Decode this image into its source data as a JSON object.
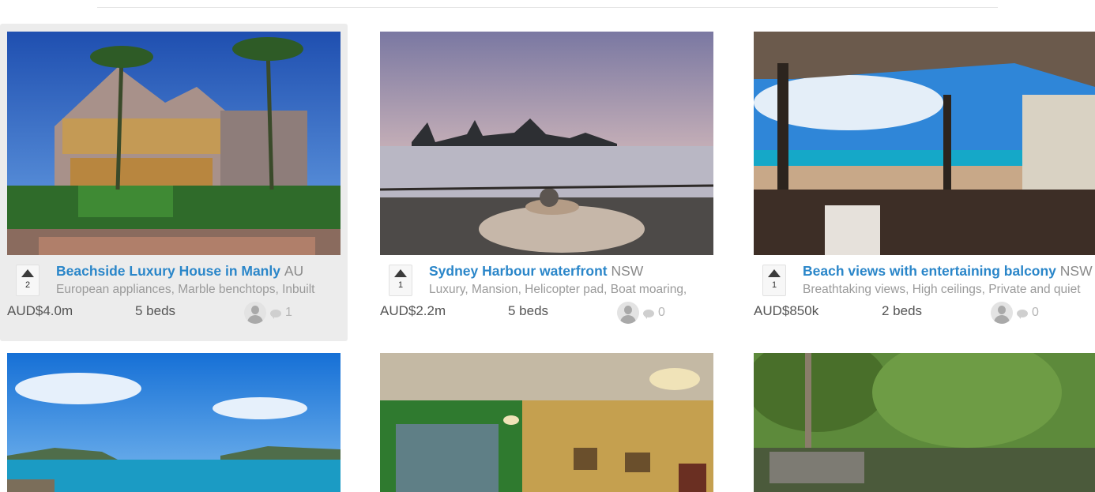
{
  "listings": [
    {
      "title": "Beachside Luxury House in Manly",
      "region": "AU",
      "description": "European appliances, Marble benchtops, Inbuilt",
      "votes": "2",
      "price": "AUD$4.0m",
      "beds": "5 beds",
      "comments": "1"
    },
    {
      "title": "Sydney Harbour waterfront",
      "region": "NSW",
      "description": "Luxury, Mansion, Helicopter pad, Boat moaring,",
      "votes": "1",
      "price": "AUD$2.2m",
      "beds": "5 beds",
      "comments": "0"
    },
    {
      "title": "Beach views with entertaining balcony",
      "region": "NSW",
      "description": "Breathtaking views, High ceilings, Private and quiet",
      "votes": "1",
      "price": "AUD$850k",
      "beds": "2 beds",
      "comments": "0"
    }
  ],
  "icons": {
    "vote": "upvote-arrow-icon",
    "avatar": "user-avatar-icon",
    "comment": "comment-bubble-icon"
  },
  "colors": {
    "title": "#2a86c9",
    "highlight": "#ececec"
  }
}
